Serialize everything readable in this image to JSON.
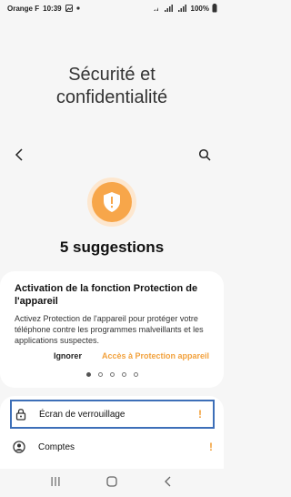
{
  "status_bar": {
    "carrier": "Orange F",
    "time": "10:39",
    "battery": "100%"
  },
  "page": {
    "title_line1": "Sécurité et",
    "title_line2": "confidentialité",
    "suggestions": "5 suggestions"
  },
  "card": {
    "title": "Activation de la fonction Protection de l'appareil",
    "text": "Activez Protection de l'appareil pour protéger votre téléphone contre les programmes malveillants et les applications suspectes.",
    "ignore_label": "Ignorer",
    "access_label": "Accès à Protection appareil"
  },
  "pagination": {
    "total": 5,
    "active": 0
  },
  "list": {
    "items": [
      {
        "label": "Écran de verrouillage",
        "warning": "!"
      },
      {
        "label": "Comptes",
        "warning": "!"
      }
    ]
  },
  "colors": {
    "accent": "#f7a64a",
    "accent_text": "#f2a13c",
    "focus_border": "#3d6fb8",
    "background": "#f6f6f6"
  },
  "icons": [
    "back-arrow-icon",
    "search-icon",
    "shield-warning-icon",
    "lock-icon",
    "account-icon",
    "recents-icon",
    "home-icon",
    "back-icon"
  ]
}
